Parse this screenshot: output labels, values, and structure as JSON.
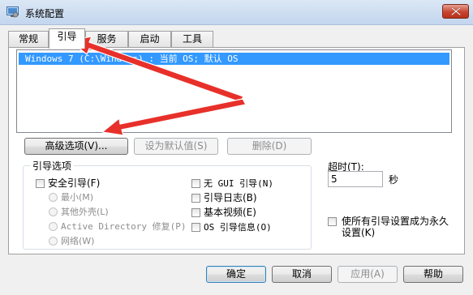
{
  "window": {
    "title": "系统配置",
    "title_icon": "msconfig-icon",
    "close_icon": "close-icon"
  },
  "tabs": [
    {
      "label": "常规",
      "active": false
    },
    {
      "label": "引导",
      "active": true
    },
    {
      "label": "服务",
      "active": false
    },
    {
      "label": "启动",
      "active": false
    },
    {
      "label": "工具",
      "active": false
    }
  ],
  "os_list": {
    "items": [
      "Windows 7 (C:\\Windows) : 当前 OS; 默认 OS"
    ]
  },
  "os_buttons": {
    "advanced": "高级选项(V)...",
    "set_default": "设为默认值(S)",
    "delete": "删除(D)"
  },
  "boot_options": {
    "group_label": "引导选项",
    "safe_boot": "安全引导(F)",
    "radios": [
      "最小(M)",
      "其他外壳(L)",
      "Active Directory 修复(P)",
      "网络(W)"
    ],
    "right_checks": [
      "无 GUI 引导(N)",
      "引导日志(B)",
      "基本视频(E)",
      "OS 引导信息(O)"
    ]
  },
  "timeout": {
    "label": "超时(T):",
    "value": "5",
    "unit": "秒"
  },
  "permanent": {
    "label": "使所有引导设置成为永久设置(K)"
  },
  "footer": {
    "ok": "确定",
    "cancel": "取消",
    "apply": "应用(A)",
    "help": "帮助"
  },
  "annotation_color": "#e8302a"
}
